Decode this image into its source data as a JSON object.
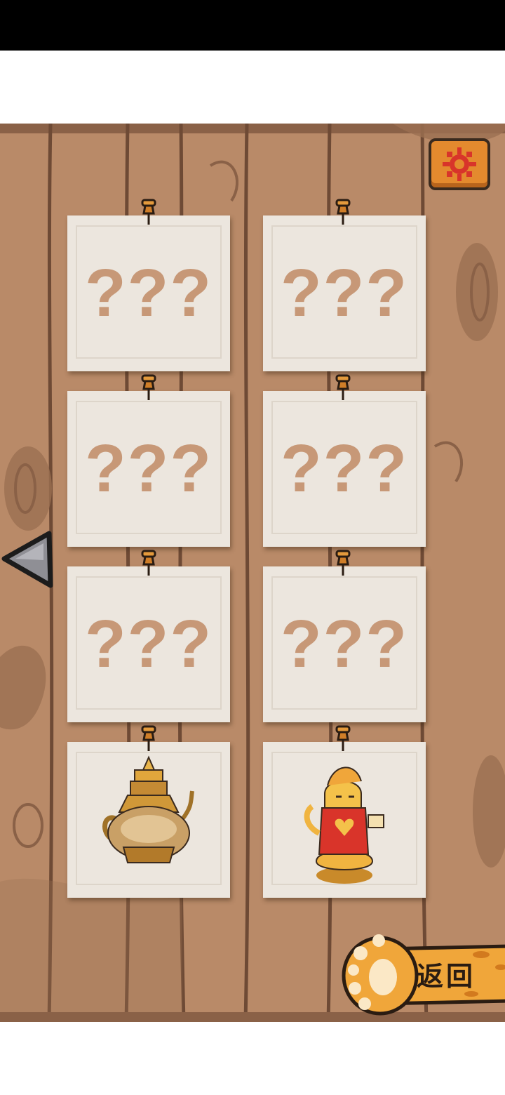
{
  "status_bar": {},
  "settings": {
    "icon": "gear-icon",
    "color": "#e48a2e"
  },
  "navigation": {
    "prev_icon": "triangle-left-icon"
  },
  "collection": {
    "cards": [
      {
        "label": "???",
        "locked": true
      },
      {
        "label": "???",
        "locked": true
      },
      {
        "label": "???",
        "locked": true
      },
      {
        "label": "???",
        "locked": true
      },
      {
        "label": "???",
        "locked": true
      },
      {
        "label": "???",
        "locked": true
      },
      {
        "label": "",
        "locked": false,
        "icon": "teapot-icon"
      },
      {
        "label": "",
        "locked": false,
        "icon": "cat-figurine-icon"
      }
    ]
  },
  "footer": {
    "return_label": "返回",
    "button_color": "#f0a63a"
  }
}
